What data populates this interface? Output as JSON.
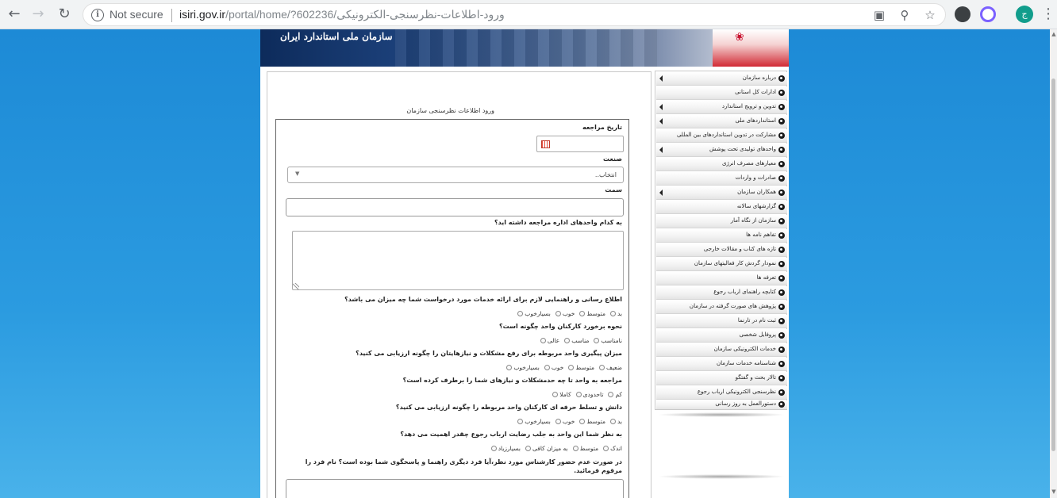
{
  "browser": {
    "back_icon": "arrow-left-icon",
    "forward_icon": "arrow-right-icon",
    "reload_icon": "reload-icon",
    "security_label": "Not secure",
    "url_host": "isiri.gov.ir",
    "url_path": "/portal/home/?602236/ورود-اطلاعات-نظرسنجی-الکترونیکی",
    "avatar_letter": "ج"
  },
  "banner": {
    "title": "سازمان ملی استاندارد ایران"
  },
  "form": {
    "heading": "ورود اطلاعات نظرسنجی سازمان",
    "date_label": "تاریخ مراجعه",
    "industry_label": "صنعت",
    "industry_selected": "انتخاب..",
    "position_label": "سمت",
    "units_question": "به کدام واحدهای اداره مراجعه داشته اید؟",
    "questions": [
      {
        "text": "اطلاع رسانی و راهنمایی لازم برای ارائه خدمات مورد درخواست شما چه میزان می باشد؟",
        "options": [
          "بسیارخوب",
          "خوب",
          "متوسط",
          "بد"
        ]
      },
      {
        "text": "نحوه برخورد کارکنان واحد چگونه است؟",
        "options": [
          "عالی",
          "مناسب",
          "نامناسب"
        ]
      },
      {
        "text": "میزان پیگیری واحد مربوطه برای رفع مشکلات و نیازهایتان را چگونه ارزیابی می کنید؟",
        "options": [
          "بسیارخوب",
          "خوب",
          "متوسط",
          "ضعیف"
        ]
      },
      {
        "text": "مراجعه به واحد تا چه حدمشکلات و نیازهای شما را برطرف کرده است؟",
        "options": [
          "کاملا",
          "تاحدودی",
          "کم"
        ]
      },
      {
        "text": "دانش و تسلط حرفه ای کارکنان واحد مربوطه را چگونه ارزیابی می کنید؟",
        "options": [
          "بسیارخوب",
          "خوب",
          "متوسط",
          "بد"
        ]
      },
      {
        "text": "به نظر شما این واحد به جلب رضایت ارباب رجوع چقدر اهمیت می دهد؟",
        "options": [
          "بسیارزیاد",
          "به میزان کافی",
          "متوسط",
          "اندک"
        ]
      }
    ],
    "absence_question": "در صورت عدم حضور کارشناس مورد نظر،آیا فرد دیگری راهنما و پاسخگوی شما بوده است؟ نام فرد را مرقوم فرمائید."
  },
  "sidebar": {
    "items": [
      {
        "label": "درباره سازمان",
        "arrow": true
      },
      {
        "label": "ادارات کل استانی",
        "arrow": false
      },
      {
        "label": "تدوین و ترویج استاندارد",
        "arrow": true
      },
      {
        "label": "استانداردهای ملی",
        "arrow": true
      },
      {
        "label": "مشارکت در تدوین استانداردهای بین المللی",
        "arrow": false
      },
      {
        "label": "واحدهای تولیدی تحت پوشش",
        "arrow": true
      },
      {
        "label": "معیارهای مصرف انرژی",
        "arrow": false
      },
      {
        "label": "صادرات و واردات",
        "arrow": false
      },
      {
        "label": "همکاران سازمان",
        "arrow": true
      },
      {
        "label": "گزارشهای سالانه",
        "arrow": false
      },
      {
        "label": "سازمان از نگاه آمار",
        "arrow": false
      },
      {
        "label": "تفاهم نامه ها",
        "arrow": false
      },
      {
        "label": "تازه های کتاب و مقالات خارجی",
        "arrow": false
      },
      {
        "label": "نمودار گردش کار فعالیتهای سازمان",
        "arrow": false
      },
      {
        "label": "تعرفه ها",
        "arrow": false
      },
      {
        "label": "کتابچه راهنمای ارباب رجوع",
        "arrow": false
      },
      {
        "label": "پژوهش های صورت گرفته در سازمان",
        "arrow": false
      },
      {
        "label": "ثبت نام در تارنما",
        "arrow": false
      },
      {
        "label": "پروفایل شخصی",
        "arrow": false
      },
      {
        "label": "خدمات الکترونیکی سازمان",
        "arrow": false
      },
      {
        "label": "شناسنامه خدمات سازمان",
        "arrow": false
      },
      {
        "label": "تالار بحث و گفتگو",
        "arrow": false
      },
      {
        "label": "نظرسنجی الکترونیکی ارباب رجوع",
        "arrow": false
      },
      {
        "label": "دستورالعمل به روز رسانی",
        "arrow": false
      }
    ]
  }
}
